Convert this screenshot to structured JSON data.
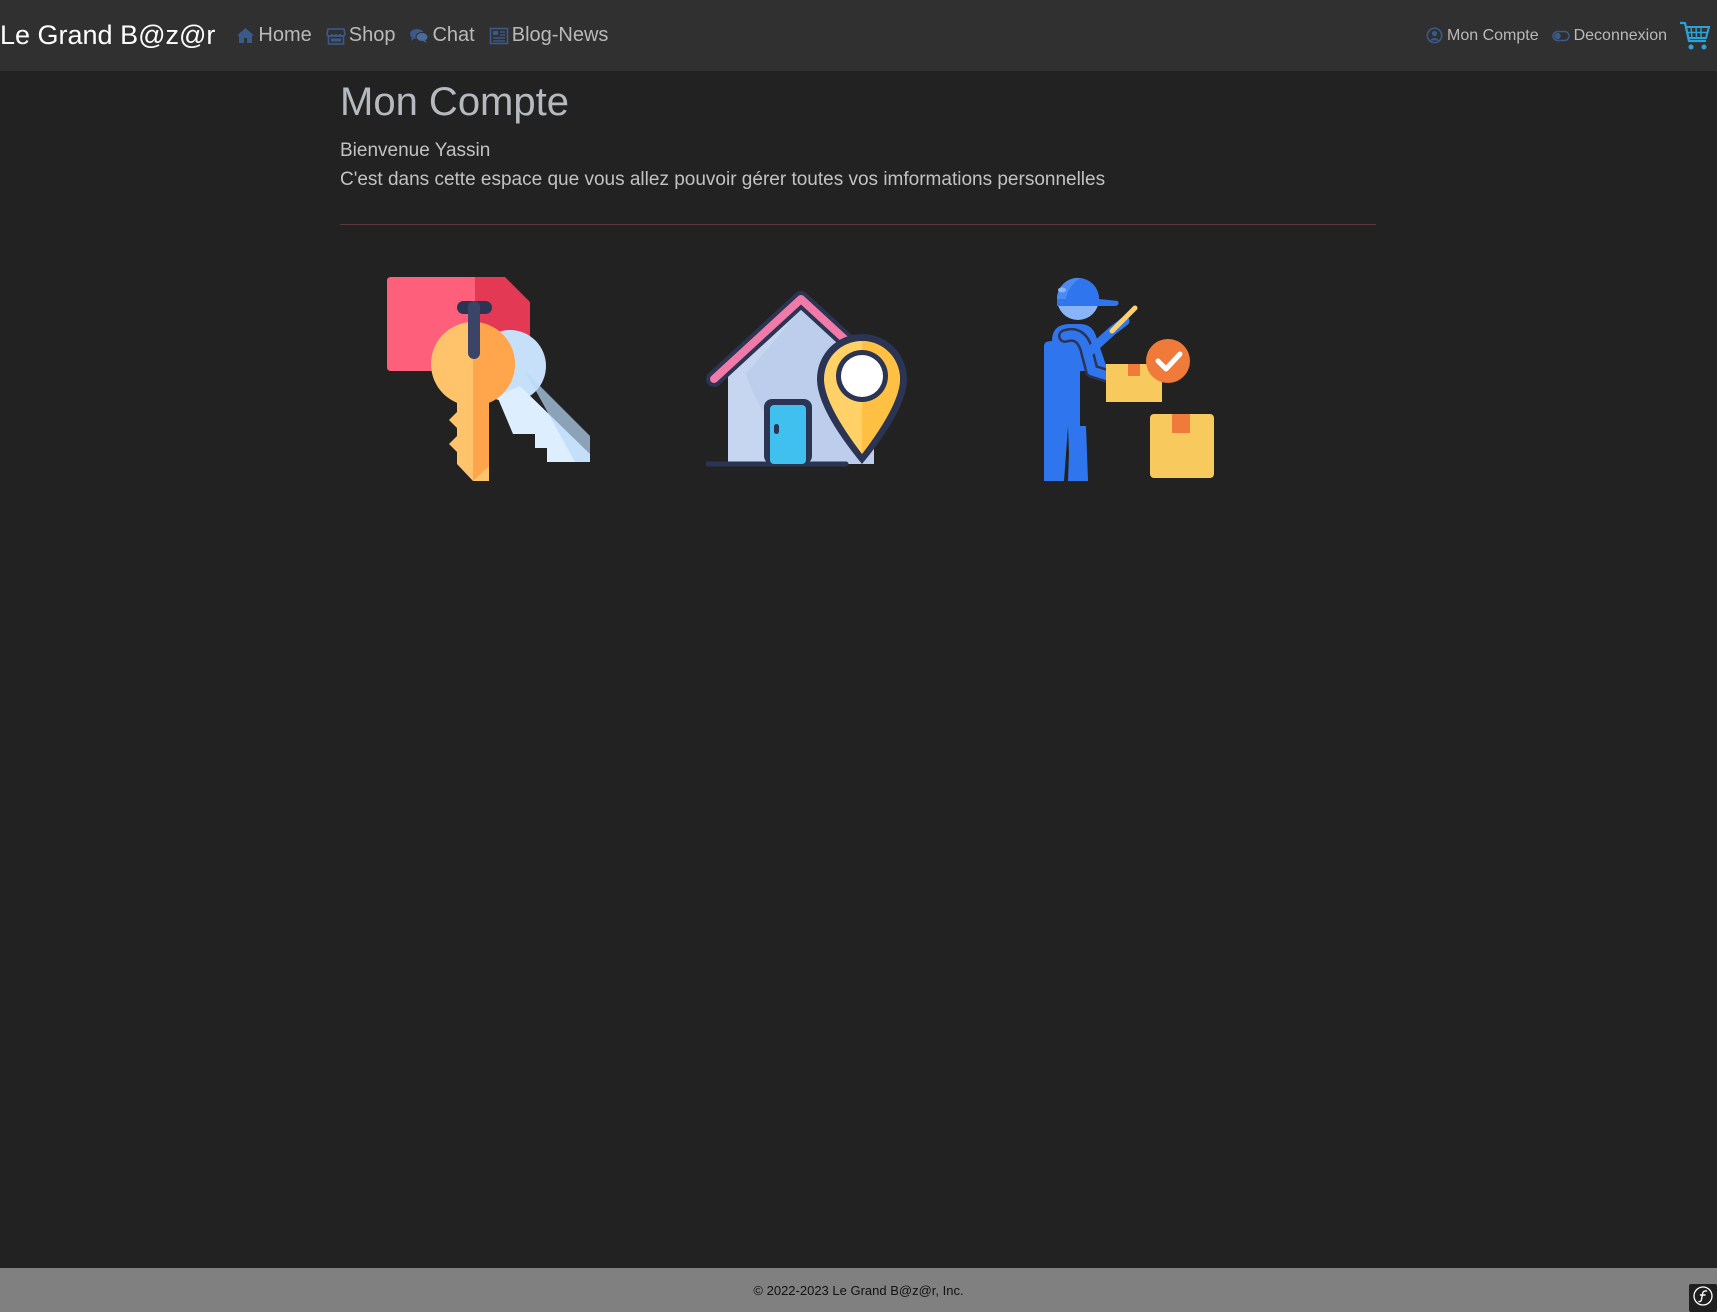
{
  "navbar": {
    "brand": "Le Grand B@z@r",
    "links": [
      {
        "label": "Home",
        "icon": "home-icon"
      },
      {
        "label": "Shop",
        "icon": "store-icon"
      },
      {
        "label": "Chat",
        "icon": "comments-icon"
      },
      {
        "label": "Blog-News",
        "icon": "newspaper-icon"
      }
    ],
    "right_links": [
      {
        "label": "Mon Compte",
        "icon": "user-circle-icon"
      },
      {
        "label": "Deconnexion",
        "icon": "toggle-icon"
      }
    ],
    "cart_icon": "shopping-cart-icon",
    "colors": {
      "background": "#303030",
      "icon_accent": "#3a5a8c",
      "cart": "#2ba3d8"
    }
  },
  "main": {
    "title": "Mon Compte",
    "welcome": "Bienvenue Yassin",
    "description": "C'est dans cette espace que vous allez pouvoir gérer toutes vos imformations personnelles",
    "tiles": [
      {
        "name": "password-keys-tile",
        "icon": "keys-tag-icon"
      },
      {
        "name": "addresses-tile",
        "icon": "house-location-icon"
      },
      {
        "name": "orders-tile",
        "icon": "delivery-man-icon"
      }
    ]
  },
  "footer": {
    "text": "© 2022-2023 Le Grand B@z@r, Inc."
  },
  "colors": {
    "page_background": "#222222",
    "footer_background": "#808080",
    "divider": "#5a3a40"
  }
}
